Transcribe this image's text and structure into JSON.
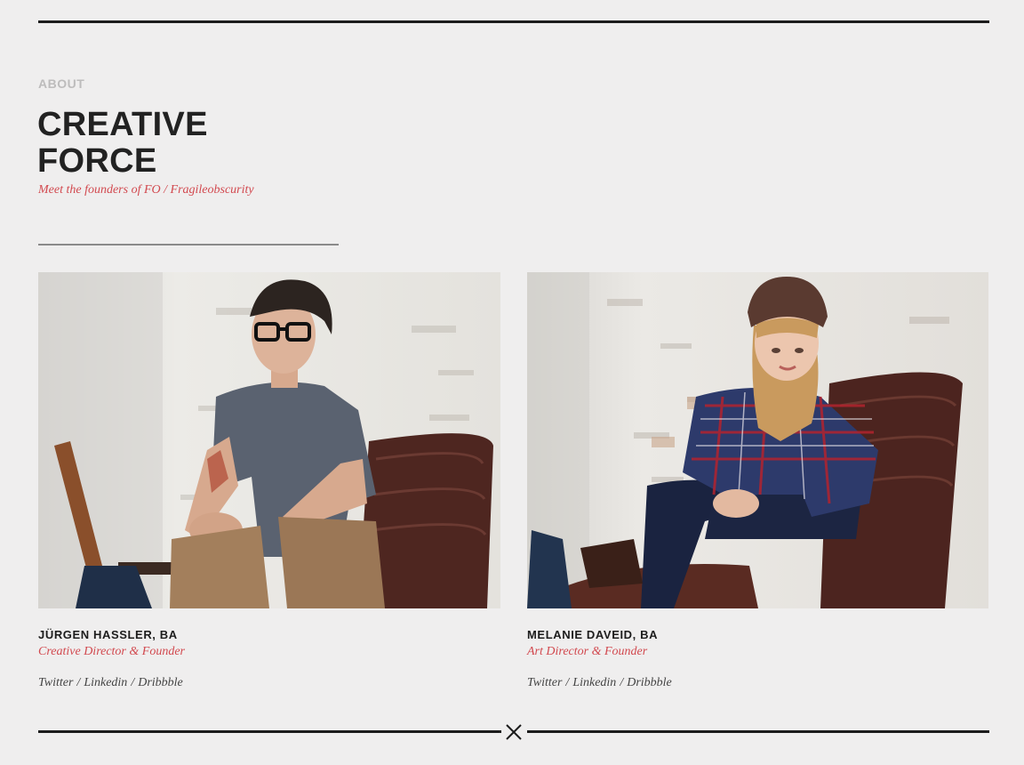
{
  "section": {
    "eyebrow": "ABOUT",
    "title_line1": "CREATIVE",
    "title_line2": "FORCE",
    "subtitle": "Meet the founders of FO / Fragileobscurity"
  },
  "founders": [
    {
      "name": "JÜRGEN HASSLER, BA",
      "role": "Creative Director & Founder",
      "links": [
        "Twitter",
        "Linkedin",
        "Dribbble"
      ]
    },
    {
      "name": "MELANIE DAVEID, BA",
      "role": "Art Director & Founder",
      "links": [
        "Twitter",
        "Linkedin",
        "Dribbble"
      ]
    }
  ],
  "separator": "/",
  "icons": {
    "footer_mark": "close-x-icon"
  },
  "colors": {
    "accent": "#d2494f",
    "text": "#1c1c1c",
    "background": "#efeeee"
  }
}
